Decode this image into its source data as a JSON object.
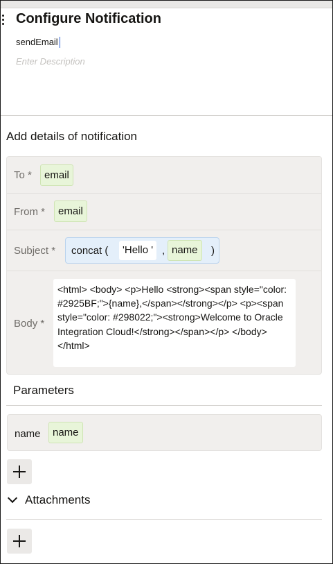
{
  "header": {
    "title": "Configure Notification",
    "name_value": "sendEmail",
    "description_placeholder": "Enter Description"
  },
  "details": {
    "section_title": "Add details of notification",
    "to": {
      "label": "To *",
      "value": "email"
    },
    "from": {
      "label": "From *",
      "value": "email"
    },
    "subject": {
      "label": "Subject *",
      "function_open": "concat (",
      "arg_string": "'Hello '",
      "separator": ",",
      "arg_var": "name",
      "function_close": ")"
    },
    "body": {
      "label": "Body *",
      "value": "<html> <body> <p>Hello <strong><span style=\"color: #2925BF;\">{name},</span></strong></p> <p><span style=\"color: #298022;\"><strong>Welcome to Oracle Integration Cloud!</strong></span></p> </body> </html>"
    }
  },
  "parameters": {
    "title": "Parameters",
    "items": [
      {
        "name": "name",
        "value": "name"
      }
    ]
  },
  "attachments": {
    "title": "Attachments"
  },
  "icons": {
    "drag": "drag-handle-icon",
    "add": "plus-icon",
    "collapse": "chevron-down-icon"
  },
  "colors": {
    "chip_bg": "#e8f5d9",
    "function_bg": "#e4effa",
    "panel_bg": "#f1efed"
  }
}
